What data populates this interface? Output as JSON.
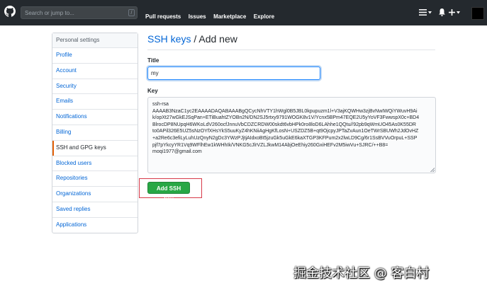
{
  "header": {
    "search_placeholder": "Search or jump to...",
    "search_shortcut": "/",
    "nav": [
      "Pull requests",
      "Issues",
      "Marketplace",
      "Explore"
    ],
    "bell_icon": "bell-icon",
    "plus_icon": "plus-icon",
    "menu_icon": "hamburger-icon"
  },
  "sidebar": {
    "heading": "Personal settings",
    "items": [
      {
        "label": "Profile"
      },
      {
        "label": "Account"
      },
      {
        "label": "Security"
      },
      {
        "label": "Emails"
      },
      {
        "label": "Notifications"
      },
      {
        "label": "Billing"
      },
      {
        "label": "SSH and GPG keys"
      },
      {
        "label": "Blocked users"
      },
      {
        "label": "Repositories"
      },
      {
        "label": "Organizations"
      },
      {
        "label": "Saved replies"
      },
      {
        "label": "Applications"
      }
    ],
    "active_index": 6
  },
  "main": {
    "breadcrumb_link": "SSH keys",
    "breadcrumb_sep": " / ",
    "breadcrumb_current": "Add new",
    "title_label": "Title",
    "title_value": "my",
    "key_label": "Key",
    "key_lines": [
      "ssh-rsa",
      "AAAAB3NzaC1yc2EAAAADAQABAAABgQCycNhVTY1hWgl0B5JBL0kpupuzm1l+V3ajKQWHw3zjBvNwIWQiYWuvH9Ai",
      "k/opXt27wGkEJSqPan+ETiBuahtZYOBn2N/DN2SJ5rtxy9791WOGK8v1V/Ycnx5BPm47EQE2U5yYoVF3FwwspX0c+BD4",
      "BlrocDP8NUpqH6WKoLdV260ocfJnnuVbCDZCRDW00skdt6vbHPk0ro8loD6LAhhe1QQtu//92pb9qWmUO45As0K55DR",
      "to0APil326E5UZ5sNzOYfXHsYkS5uuKyZ4hKNiiAgHgKfLosN+USZDZ5B+qt9OjcpyJPTaZvAun1OeTWrSBUWh2JdOvHZ",
      "+a2Re6c3efiLyLuhUzQnyN2gDc3YWzPJjtjAIdxoBt5jzuGk5uGkE6kaXTGP3KFPum2x2lwLD9Cg/6r1SsBVVuOrpuL+SSP",
      "pjf7pYkcyYR1Vq9WFlhEw1kWHhIk/VNKG5cJlrVZLJkwM14AbjOeEhiy260GxiHEFv2M5iwVu+SJRC/++B8=",
      "moqi1977@gmail.com"
    ],
    "add_button": "Add SSH key"
  },
  "watermark": "掘金技术社区 @ 客白村"
}
